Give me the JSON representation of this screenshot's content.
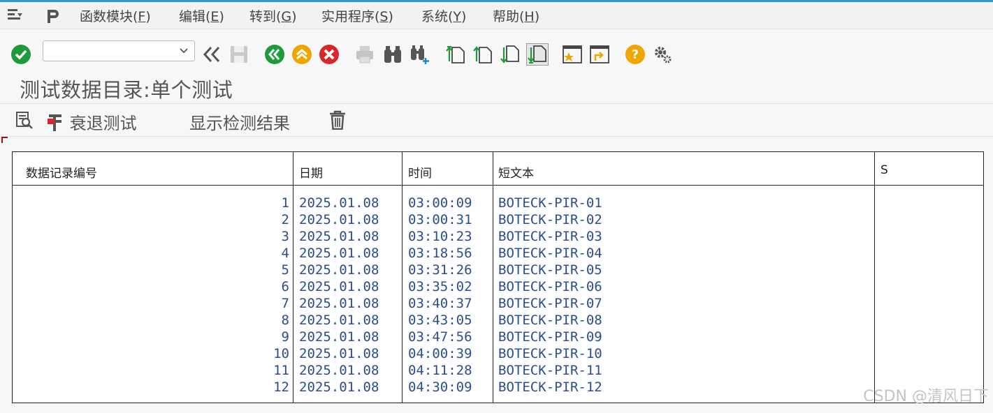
{
  "menu": {
    "items": [
      {
        "text": "函数模块(",
        "key": "F",
        "end": ")"
      },
      {
        "text": "编辑(",
        "key": "E",
        "end": ")"
      },
      {
        "text": "转到(",
        "key": "G",
        "end": ")"
      },
      {
        "text": "实用程序(",
        "key": "S",
        "end": ")"
      },
      {
        "text": "系统(",
        "key": "Y",
        "end": ")"
      },
      {
        "text": "帮助(",
        "key": "H",
        "end": ")"
      }
    ]
  },
  "toolbar": {
    "command_field_value": ""
  },
  "page": {
    "title": "测试数据目录:单个测试"
  },
  "subtoolbar": {
    "regression_label": "衰退测试",
    "show_results_label": "显示检测结果"
  },
  "table": {
    "headers": [
      "数据记录编号",
      "日期",
      "时间",
      "短文本",
      "S"
    ],
    "rows": [
      {
        "no": "1",
        "date": "2025.01.08",
        "time": "03:00:09",
        "text": "BOTECK-PIR-01"
      },
      {
        "no": "2",
        "date": "2025.01.08",
        "time": "03:00:31",
        "text": "BOTECK-PIR-02"
      },
      {
        "no": "3",
        "date": "2025.01.08",
        "time": "03:10:23",
        "text": "BOTECK-PIR-03"
      },
      {
        "no": "4",
        "date": "2025.01.08",
        "time": "03:18:56",
        "text": "BOTECK-PIR-04"
      },
      {
        "no": "5",
        "date": "2025.01.08",
        "time": "03:31:26",
        "text": "BOTECK-PIR-05"
      },
      {
        "no": "6",
        "date": "2025.01.08",
        "time": "03:35:02",
        "text": "BOTECK-PIR-06"
      },
      {
        "no": "7",
        "date": "2025.01.08",
        "time": "03:40:37",
        "text": "BOTECK-PIR-07"
      },
      {
        "no": "8",
        "date": "2025.01.08",
        "time": "03:43:05",
        "text": "BOTECK-PIR-08"
      },
      {
        "no": "9",
        "date": "2025.01.08",
        "time": "03:47:56",
        "text": "BOTECK-PIR-09"
      },
      {
        "no": "10",
        "date": "2025.01.08",
        "time": "04:00:39",
        "text": "BOTECK-PIR-10"
      },
      {
        "no": "11",
        "date": "2025.01.08",
        "time": "04:11:28",
        "text": "BOTECK-PIR-11"
      },
      {
        "no": "12",
        "date": "2025.01.08",
        "time": "04:30:09",
        "text": "BOTECK-PIR-12"
      }
    ]
  },
  "watermark": "CSDN @清风日下",
  "colors": {
    "accent_blue": "#2f9ad6",
    "cell_text": "#2a4e8f",
    "ok_green": "#1f9a3a",
    "warn_orange": "#f0a500",
    "cancel_red": "#d9262b"
  }
}
